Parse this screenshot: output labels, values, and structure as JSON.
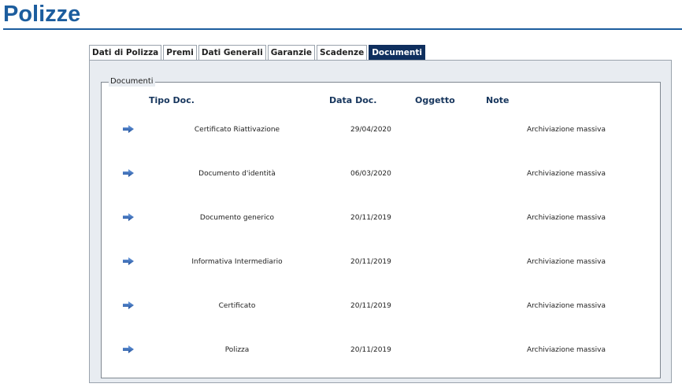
{
  "page": {
    "title": "Polizze"
  },
  "tabs": [
    {
      "label": "Dati di Polizza",
      "active": false
    },
    {
      "label": "Premi",
      "active": false
    },
    {
      "label": "Dati Generali",
      "active": false
    },
    {
      "label": "Garanzie",
      "active": false
    },
    {
      "label": "Scadenze",
      "active": false
    },
    {
      "label": "Documenti",
      "active": true
    }
  ],
  "documents": {
    "legend": "Documenti",
    "headers": {
      "tipo": "Tipo Doc.",
      "data": "Data Doc.",
      "oggetto": "Oggetto",
      "note": "Note"
    },
    "rows": [
      {
        "icon": "arrow-right-icon",
        "tipo": "Certificato Riattivazione",
        "data": "29/04/2020",
        "oggetto": "",
        "note": "Archiviazione massiva"
      },
      {
        "icon": "arrow-right-icon",
        "tipo": "Documento d'identità",
        "data": "06/03/2020",
        "oggetto": "",
        "note": "Archiviazione massiva"
      },
      {
        "icon": "arrow-right-icon",
        "tipo": "Documento generico",
        "data": "20/11/2019",
        "oggetto": "",
        "note": "Archiviazione massiva"
      },
      {
        "icon": "arrow-right-icon",
        "tipo": "Informativa Intermediario",
        "data": "20/11/2019",
        "oggetto": "",
        "note": "Archiviazione massiva"
      },
      {
        "icon": "arrow-right-icon",
        "tipo": "Certificato",
        "data": "20/11/2019",
        "oggetto": "",
        "note": "Archiviazione massiva"
      },
      {
        "icon": "arrow-right-icon",
        "tipo": "Polizza",
        "data": "20/11/2019",
        "oggetto": "",
        "note": "Archiviazione massiva"
      }
    ]
  },
  "colors": {
    "brand": "#1c5d9e",
    "tab_active_bg": "#0f2f5e",
    "header_text": "#17365d",
    "panel_bg": "#e8ecf1"
  }
}
